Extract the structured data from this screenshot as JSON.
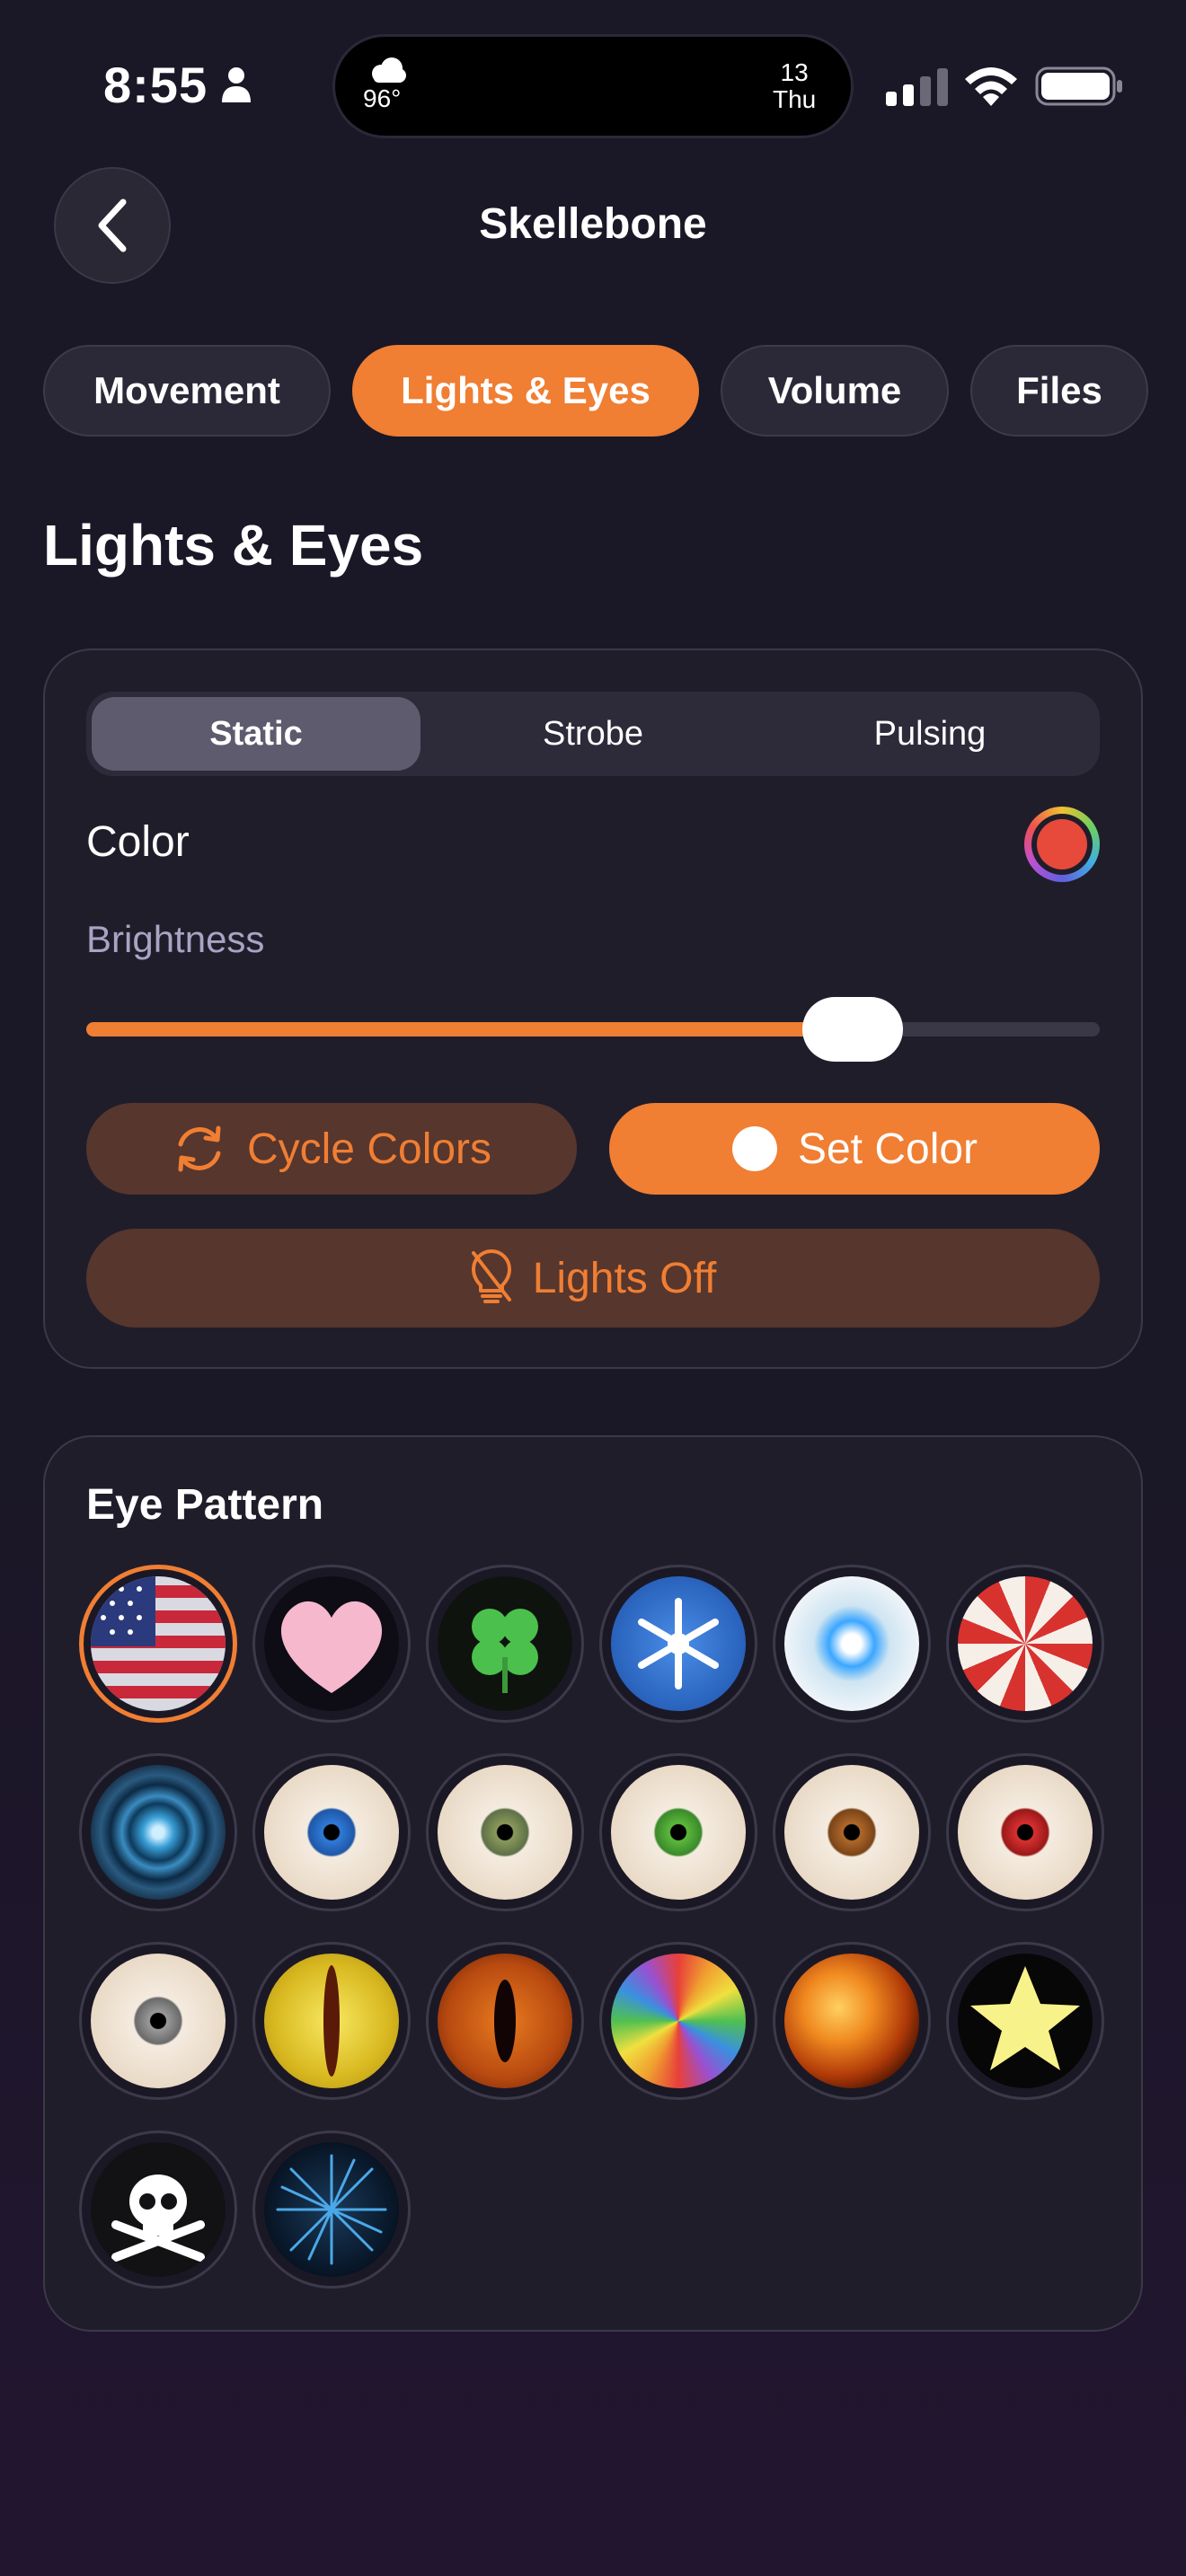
{
  "status_bar": {
    "time": "8:55",
    "temperature": "96°",
    "date_day": "13",
    "date_weekday": "Thu"
  },
  "header": {
    "title": "Skellebone"
  },
  "tabs": [
    {
      "label": "Movement",
      "active": false
    },
    {
      "label": "Lights & Eyes",
      "active": true
    },
    {
      "label": "Volume",
      "active": false
    },
    {
      "label": "Files",
      "active": false
    }
  ],
  "section": {
    "title": "Lights & Eyes"
  },
  "lights": {
    "modes": [
      {
        "label": "Static",
        "active": true
      },
      {
        "label": "Strobe",
        "active": false
      },
      {
        "label": "Pulsing",
        "active": false
      }
    ],
    "color_label": "Color",
    "selected_color": "#e74a3b",
    "brightness_label": "Brightness",
    "brightness_fraction": 0.756,
    "cycle_colors_label": "Cycle Colors",
    "set_color_label": "Set Color",
    "lights_off_label": "Lights Off"
  },
  "eye_pattern": {
    "title": "Eye Pattern",
    "selected": "american-flag",
    "patterns": [
      "american-flag",
      "pink-heart",
      "four-leaf-clover",
      "snowflake",
      "ice-blue-eye",
      "peppermint-swirl",
      "cyber-blue-eye",
      "blue-eyeball",
      "hazel-eyeball",
      "green-eyeball",
      "brown-eyeball",
      "red-eyeball",
      "gray-eyeball",
      "yellow-cat-eye",
      "orange-cat-eye",
      "rainbow-spiral",
      "fire",
      "yellow-star",
      "skull-and-crossbones",
      "blue-fireworks"
    ]
  },
  "colors": {
    "accent": "#f07e33",
    "background": "#1a1726",
    "card": "#201d2b"
  }
}
